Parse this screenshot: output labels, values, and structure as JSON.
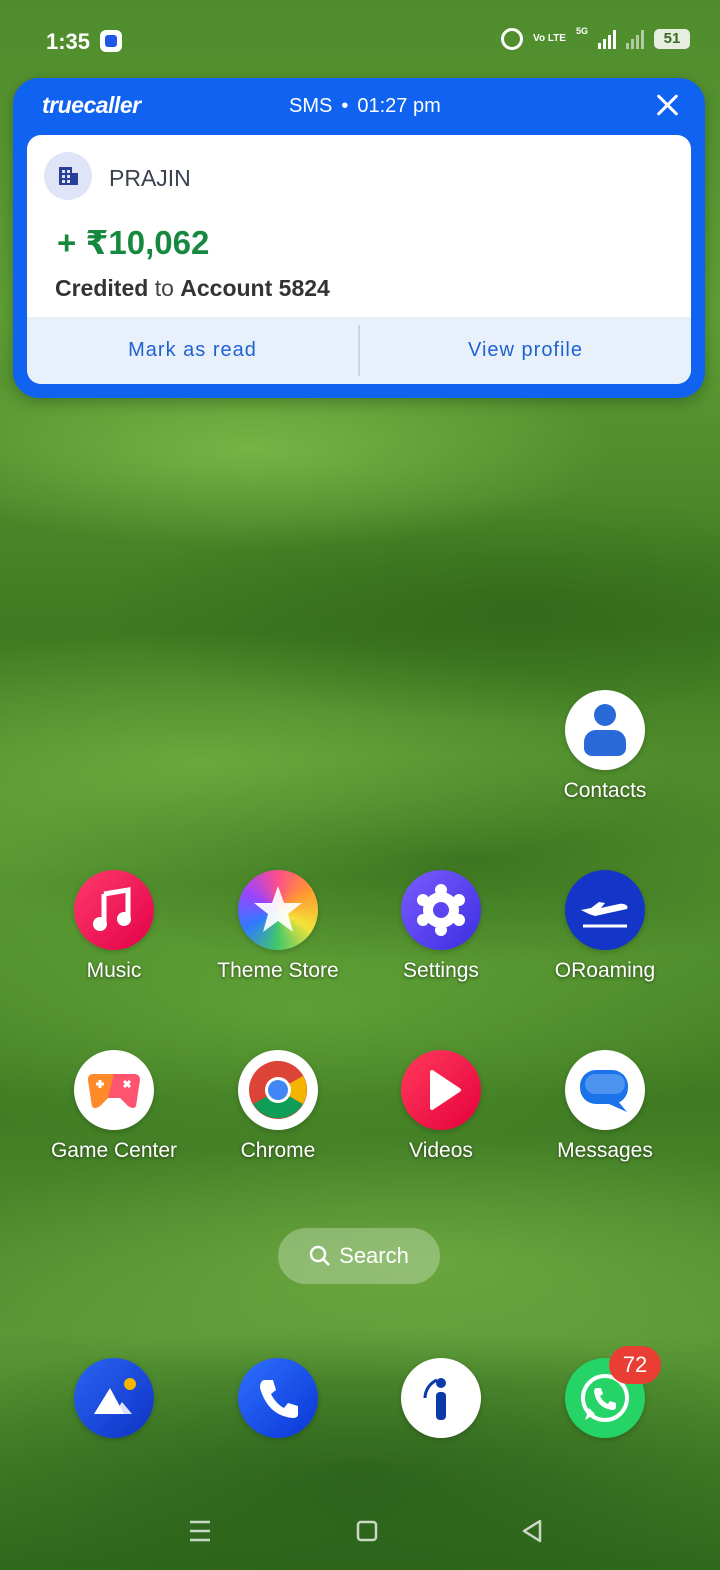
{
  "status_bar": {
    "time": "1:35",
    "network_volte": "Vo LTE",
    "network_type": "5G",
    "battery": "51"
  },
  "notification": {
    "brand": "truecaller",
    "source": "SMS",
    "separator": "•",
    "time": "01:27 pm",
    "sender": "PRAJIN",
    "amount": "+ ₹10,062",
    "credit_word": "Credited",
    "credit_to": "to",
    "account": "Account 5824",
    "actions": {
      "mark_read": "Mark as read",
      "view_profile": "View profile"
    }
  },
  "apps": {
    "contacts": "Contacts",
    "music": "Music",
    "theme_store": "Theme Store",
    "settings": "Settings",
    "oroaming": "ORoaming",
    "game_center": "Game Center",
    "chrome": "Chrome",
    "videos": "Videos",
    "messages": "Messages"
  },
  "search": {
    "label": "Search"
  },
  "dock": {
    "whatsapp_badge": "72"
  },
  "colors": {
    "truecaller_blue": "#1062f0",
    "amount_green": "#16893f",
    "action_blue": "#1f63cf",
    "badge_red": "#ea3d33"
  }
}
